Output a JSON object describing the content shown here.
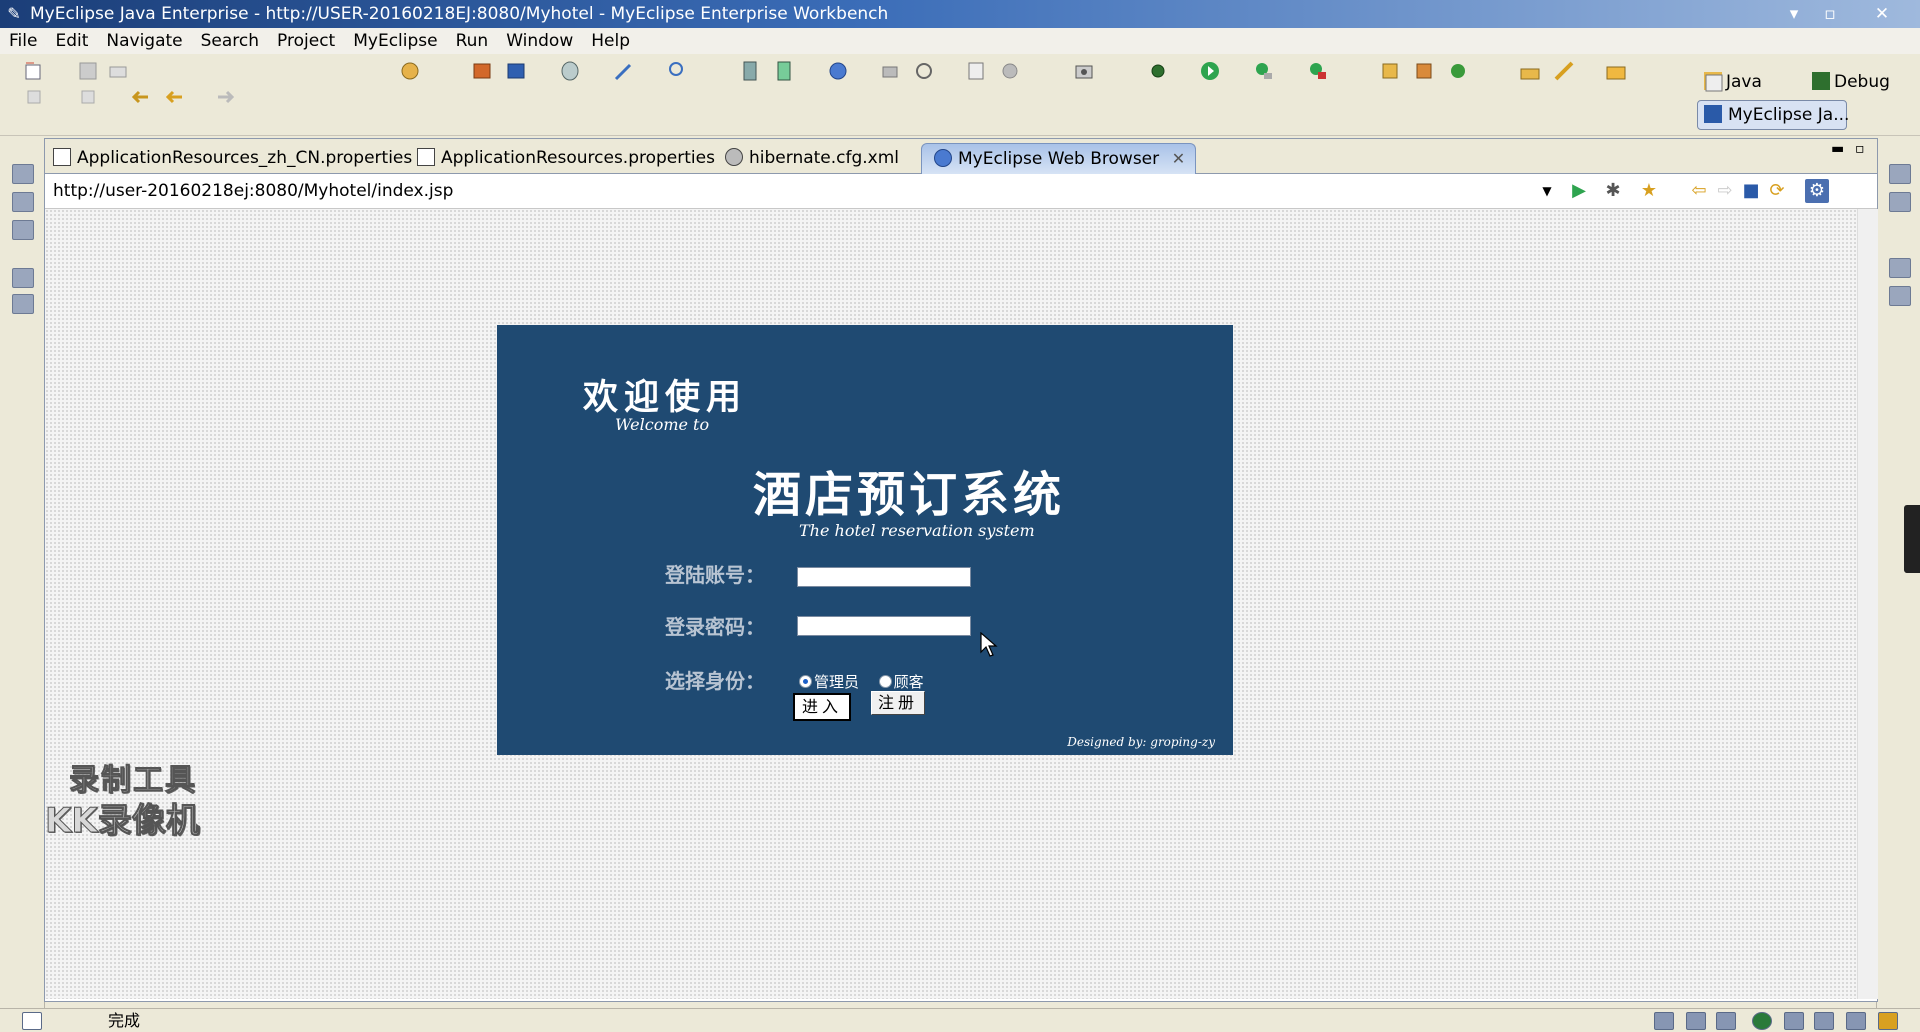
{
  "window": {
    "title": "MyEclipse Java Enterprise - http://USER-20160218EJ:8080/Myhotel - MyEclipse Enterprise Workbench",
    "controls": [
      "▾",
      "▫",
      "✕"
    ]
  },
  "menu": {
    "items": [
      "File",
      "Edit",
      "Navigate",
      "Search",
      "Project",
      "MyEclipse",
      "Run",
      "Window",
      "Help"
    ]
  },
  "perspectives": {
    "java": "Java",
    "debug": "Debug",
    "active": "MyEclipse Ja..."
  },
  "editor_tabs": [
    {
      "label": "ApplicationResources_zh_CN.properties"
    },
    {
      "label": "ApplicationResources.properties"
    },
    {
      "label": "hibernate.cfg.xml"
    },
    {
      "label": "MyEclipse Web Browser",
      "active": true
    }
  ],
  "browser": {
    "url": "http://user-20160218ej:8080/Myhotel/index.jsp"
  },
  "page": {
    "welcome_cn": "欢迎使用",
    "welcome_en": "Welcome to",
    "system_cn": "酒店预订系统",
    "system_en": "The hotel reservation system",
    "account_label": "登陆账号：",
    "password_label": "登录密码：",
    "role_label": "选择身份：",
    "role_options": [
      {
        "label": "管理员",
        "checked": true
      },
      {
        "label": "顾客",
        "checked": false
      }
    ],
    "enter_button": "进入",
    "register_button": "注册",
    "credit": "Designed by: groping-zy",
    "panel_color": "#1f4a72"
  },
  "watermark": {
    "line1": "录制工具",
    "line2": "KK录像机"
  },
  "status": {
    "text": "完成"
  }
}
